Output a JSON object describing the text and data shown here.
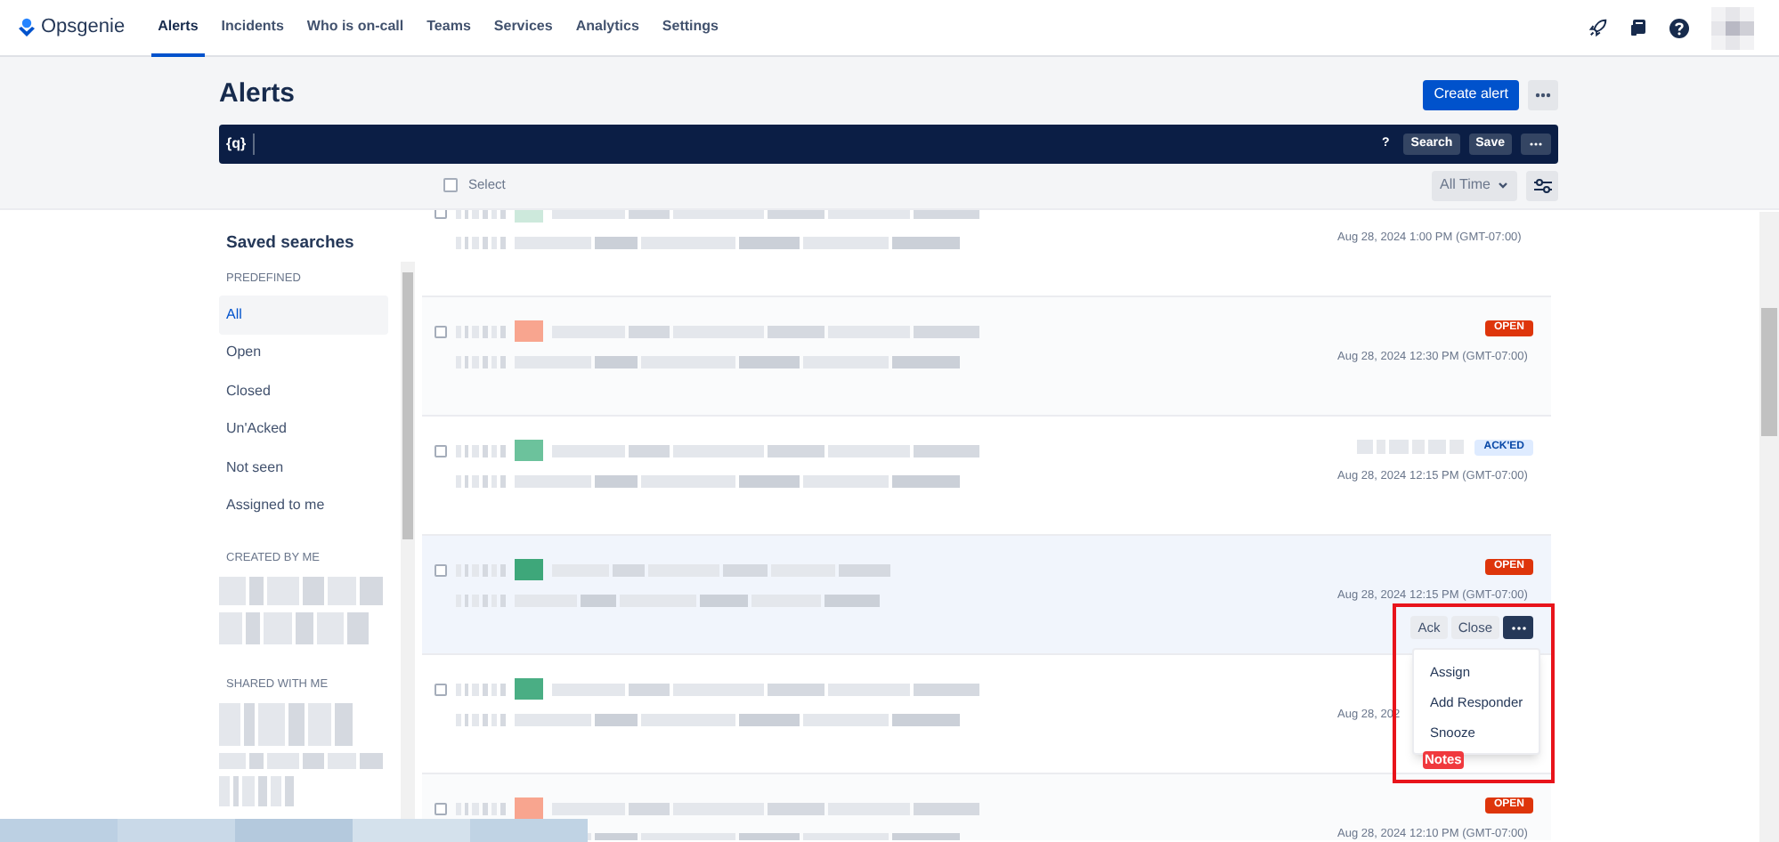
{
  "nav": {
    "brand": "Opsgenie",
    "tabs": [
      {
        "label": "Alerts",
        "selected": true
      },
      {
        "label": "Incidents",
        "selected": false
      },
      {
        "label": "Who is on-call",
        "selected": false
      },
      {
        "label": "Teams",
        "selected": false
      },
      {
        "label": "Services",
        "selected": false
      },
      {
        "label": "Analytics",
        "selected": false
      },
      {
        "label": "Settings",
        "selected": false
      }
    ]
  },
  "page": {
    "title": "Alerts",
    "create_button": "Create alert"
  },
  "search_bar": {
    "logo": "{q}",
    "help": "?",
    "buttons": [
      "Search",
      "Save"
    ]
  },
  "toolbar": {
    "select_label": "Select",
    "checked": false,
    "time_filter": "All Time"
  },
  "sidebar": {
    "title": "Saved searches",
    "sections": [
      {
        "heading": "PREDEFINED",
        "items": [
          {
            "label": "All",
            "selected": true
          },
          {
            "label": "Open",
            "selected": false
          },
          {
            "label": "Closed",
            "selected": false
          },
          {
            "label": "Un'Acked",
            "selected": false
          },
          {
            "label": "Not seen",
            "selected": false
          },
          {
            "label": "Assigned to me",
            "selected": false
          }
        ]
      },
      {
        "heading": "CREATED BY ME"
      },
      {
        "heading": "SHARED WITH ME"
      }
    ]
  },
  "alerts": [
    {
      "color": "#cde9dc",
      "checked": false,
      "time": "Aug 28, 2024 1:00 PM (GMT-07:00)"
    },
    {
      "color": "#f8a58f",
      "checked": false,
      "badge": {
        "text": "OPEN",
        "kind": "open"
      },
      "time": "Aug 28, 2024 12:30 PM (GMT-07:00)"
    },
    {
      "color": "#6cc29c",
      "checked": false,
      "badge": {
        "text": "ACK'ED",
        "kind": "acked"
      },
      "time": "Aug 28, 2024 12:15 PM (GMT-07:00)"
    },
    {
      "color": "#3ea77a",
      "checked": false,
      "badge": {
        "text": "OPEN",
        "kind": "open"
      },
      "time": "Aug 28, 2024 12:15 PM (GMT-07:00)",
      "actions": [
        "Ack",
        "Close"
      ],
      "menu": [
        "Assign",
        "Add Responder",
        "Snooze"
      ],
      "highlighted_item": "Notes"
    },
    {
      "color": "#4aae84",
      "checked": false,
      "time": "Aug 28, 202"
    },
    {
      "color": "#f8a58f",
      "checked": false,
      "badge": {
        "text": "OPEN",
        "kind": "open"
      },
      "time": "Aug 28, 2024 12:10 PM (GMT-07:00)"
    }
  ]
}
